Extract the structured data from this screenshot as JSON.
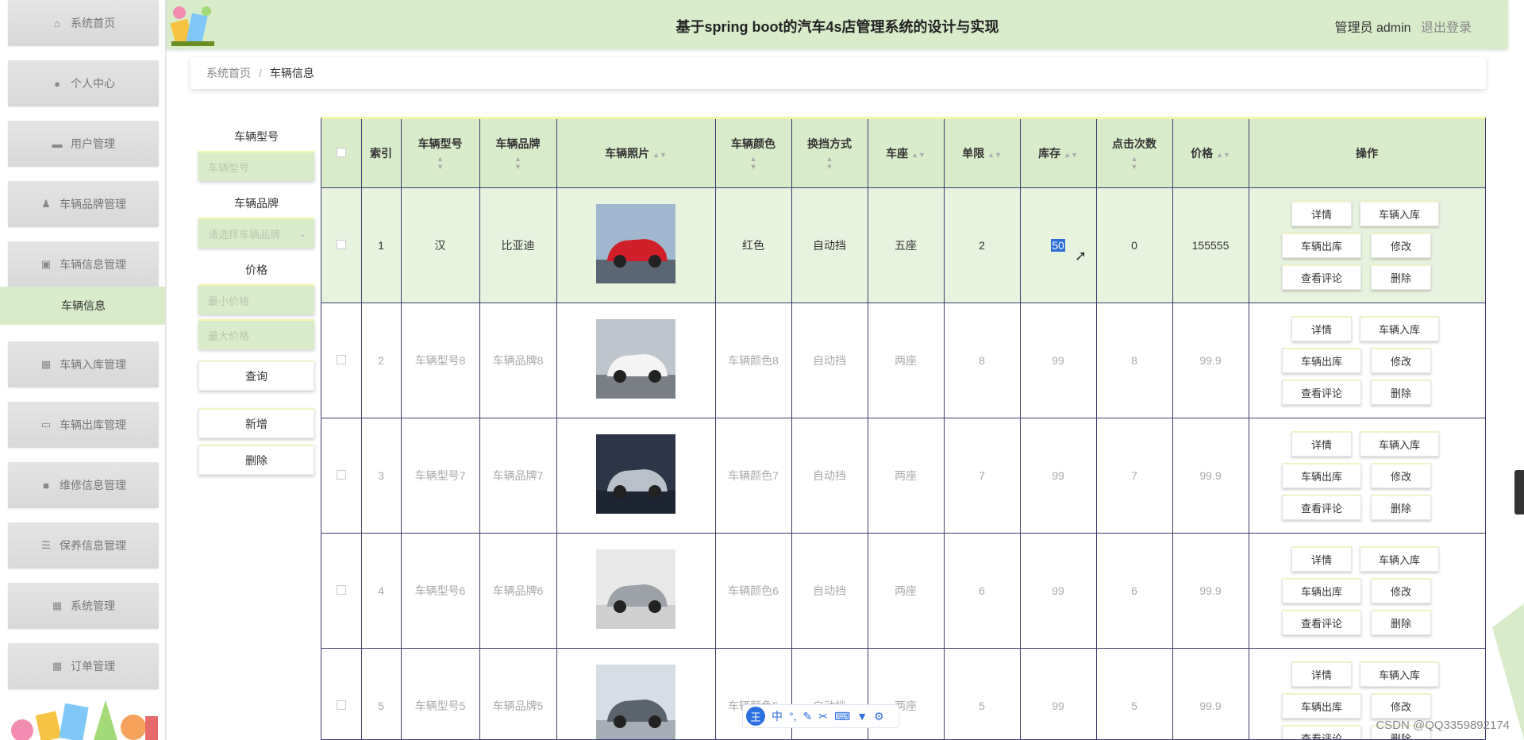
{
  "app": {
    "title": "基于spring boot的汽车4s店管理系统的设计与实现",
    "user_label": "管理员 admin",
    "logout_label": "退出登录"
  },
  "sidebar": {
    "items": [
      {
        "label": "系统首页",
        "icon": "home-icon"
      },
      {
        "label": "个人中心",
        "icon": "user-icon"
      },
      {
        "label": "用户管理",
        "icon": "monitor-icon"
      },
      {
        "label": "车辆品牌管理",
        "icon": "person-icon"
      },
      {
        "label": "车辆信息管理",
        "icon": "clipboard-icon"
      },
      {
        "label": "车辆入库管理",
        "icon": "grid-icon"
      },
      {
        "label": "车辆出库管理",
        "icon": "chat-icon"
      },
      {
        "label": "维修信息管理",
        "icon": "camera-icon"
      },
      {
        "label": "保养信息管理",
        "icon": "sliders-icon"
      },
      {
        "label": "系统管理",
        "icon": "grid-icon"
      },
      {
        "label": "订单管理",
        "icon": "grid-icon"
      }
    ],
    "active_sub": "车辆信息"
  },
  "breadcrumb": {
    "home": "系统首页",
    "separator": "/",
    "current": "车辆信息"
  },
  "search": {
    "model_label": "车辆型号",
    "model_placeholder": "车辆型号",
    "brand_label": "车辆品牌",
    "brand_placeholder": "请选择车辆品牌",
    "price_label": "价格",
    "min_price_placeholder": "最小价格",
    "max_price_placeholder": "最大价格",
    "query_button": "查询",
    "add_button": "新增",
    "delete_button": "删除"
  },
  "table": {
    "headers": {
      "index": "索引",
      "model": "车辆型号",
      "brand": "车辆品牌",
      "photo": "车辆照片",
      "color": "车辆颜色",
      "gear": "换挡方式",
      "seats": "车座",
      "limit": "单限",
      "stock": "库存",
      "clicks": "点击次数",
      "price": "价格",
      "actions": "操作"
    },
    "actions": {
      "detail": "详情",
      "stock_in": "车辆入库",
      "stock_out": "车辆出库",
      "edit": "修改",
      "view_comments": "查看评论",
      "delete": "删除"
    },
    "rows": [
      {
        "index": "1",
        "model": "汉",
        "brand": "比亚迪",
        "photo": "red-hatchback-photo",
        "color": "红色",
        "gear": "自动挡",
        "seats": "五座",
        "limit": "2",
        "stock": "50",
        "clicks": "0",
        "price": "155555"
      },
      {
        "index": "2",
        "model": "车辆型号8",
        "brand": "车辆品牌8",
        "photo": "white-sedan-photo",
        "color": "车辆颜色8",
        "gear": "自动挡",
        "seats": "两座",
        "limit": "8",
        "stock": "99",
        "clicks": "8",
        "price": "99.9"
      },
      {
        "index": "3",
        "model": "车辆型号7",
        "brand": "车辆品牌7",
        "photo": "silver-roadster-photo",
        "color": "车辆颜色7",
        "gear": "自动挡",
        "seats": "两座",
        "limit": "7",
        "stock": "99",
        "clicks": "7",
        "price": "99.9"
      },
      {
        "index": "4",
        "model": "车辆型号6",
        "brand": "车辆品牌6",
        "photo": "concept-car-photo",
        "color": "车辆颜色6",
        "gear": "自动挡",
        "seats": "两座",
        "limit": "6",
        "stock": "99",
        "clicks": "6",
        "price": "99.9"
      },
      {
        "index": "5",
        "model": "车辆型号5",
        "brand": "车辆品牌5",
        "photo": "grey-suv-photo",
        "color": "车辆颜色5",
        "gear": "自动挡",
        "seats": "两座",
        "limit": "5",
        "stock": "99",
        "clicks": "5",
        "price": "99.9"
      }
    ]
  },
  "ime": {
    "logo": "王",
    "mode": "中"
  },
  "watermark": "CSDN @QQ3359892174",
  "colors": {
    "accent_green": "#d8ecc9",
    "row_highlight": "#e8f3de",
    "border_navy": "#3c3c6e",
    "selection_blue": "#2a6ed6"
  }
}
